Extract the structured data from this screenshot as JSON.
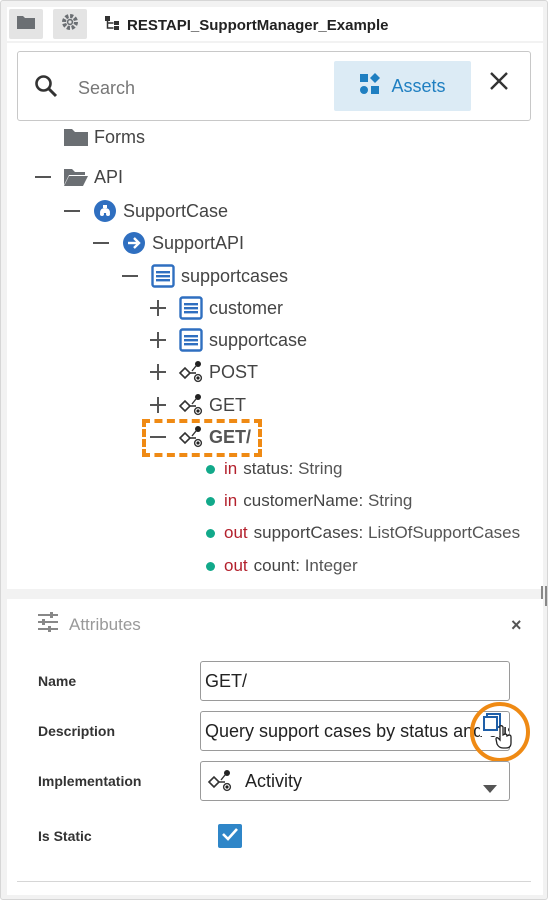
{
  "toolbar": {
    "project_title": "RESTAPI_SupportManager_Example",
    "folder_icon": "folder-icon",
    "settings_icon": "gear-icon"
  },
  "search": {
    "placeholder": "Search",
    "assets_label": "Assets"
  },
  "tree": {
    "nodes": [
      {
        "label": "Forms",
        "icon": "folder-icon"
      },
      {
        "label": "API",
        "icon": "folder-open-icon"
      },
      {
        "label": "SupportCase",
        "icon": "service-icon"
      },
      {
        "label": "SupportAPI",
        "icon": "api-icon"
      },
      {
        "label": "supportcases",
        "icon": "resource-icon"
      },
      {
        "label": "customer",
        "icon": "resource-icon"
      },
      {
        "label": "supportcase",
        "icon": "resource-icon"
      },
      {
        "label": "POST",
        "icon": "operation-icon"
      },
      {
        "label": "GET",
        "icon": "operation-icon"
      },
      {
        "label": "GET/",
        "icon": "operation-icon"
      }
    ],
    "params": [
      {
        "dir": "in",
        "name": "status:",
        "type": "String"
      },
      {
        "dir": "in",
        "name": "customerName:",
        "type": "String"
      },
      {
        "dir": "out",
        "name": "supportCases:",
        "type": "ListOfSupportCases"
      },
      {
        "dir": "out",
        "name": "count:",
        "type": "Integer"
      }
    ]
  },
  "attributes": {
    "title": "Attributes",
    "close": "×",
    "name_label": "Name",
    "name_value": "GET/",
    "description_label": "Description",
    "description_value": "Query support cases by status and customer name",
    "implementation_label": "Implementation",
    "implementation_value": "Activity",
    "static_label": "Is Static",
    "static_checked": true
  },
  "colors": {
    "accent": "#2f86c8",
    "highlight": "#ef8a14",
    "keyword": "#b3202c",
    "param_dot": "#12a98a"
  }
}
